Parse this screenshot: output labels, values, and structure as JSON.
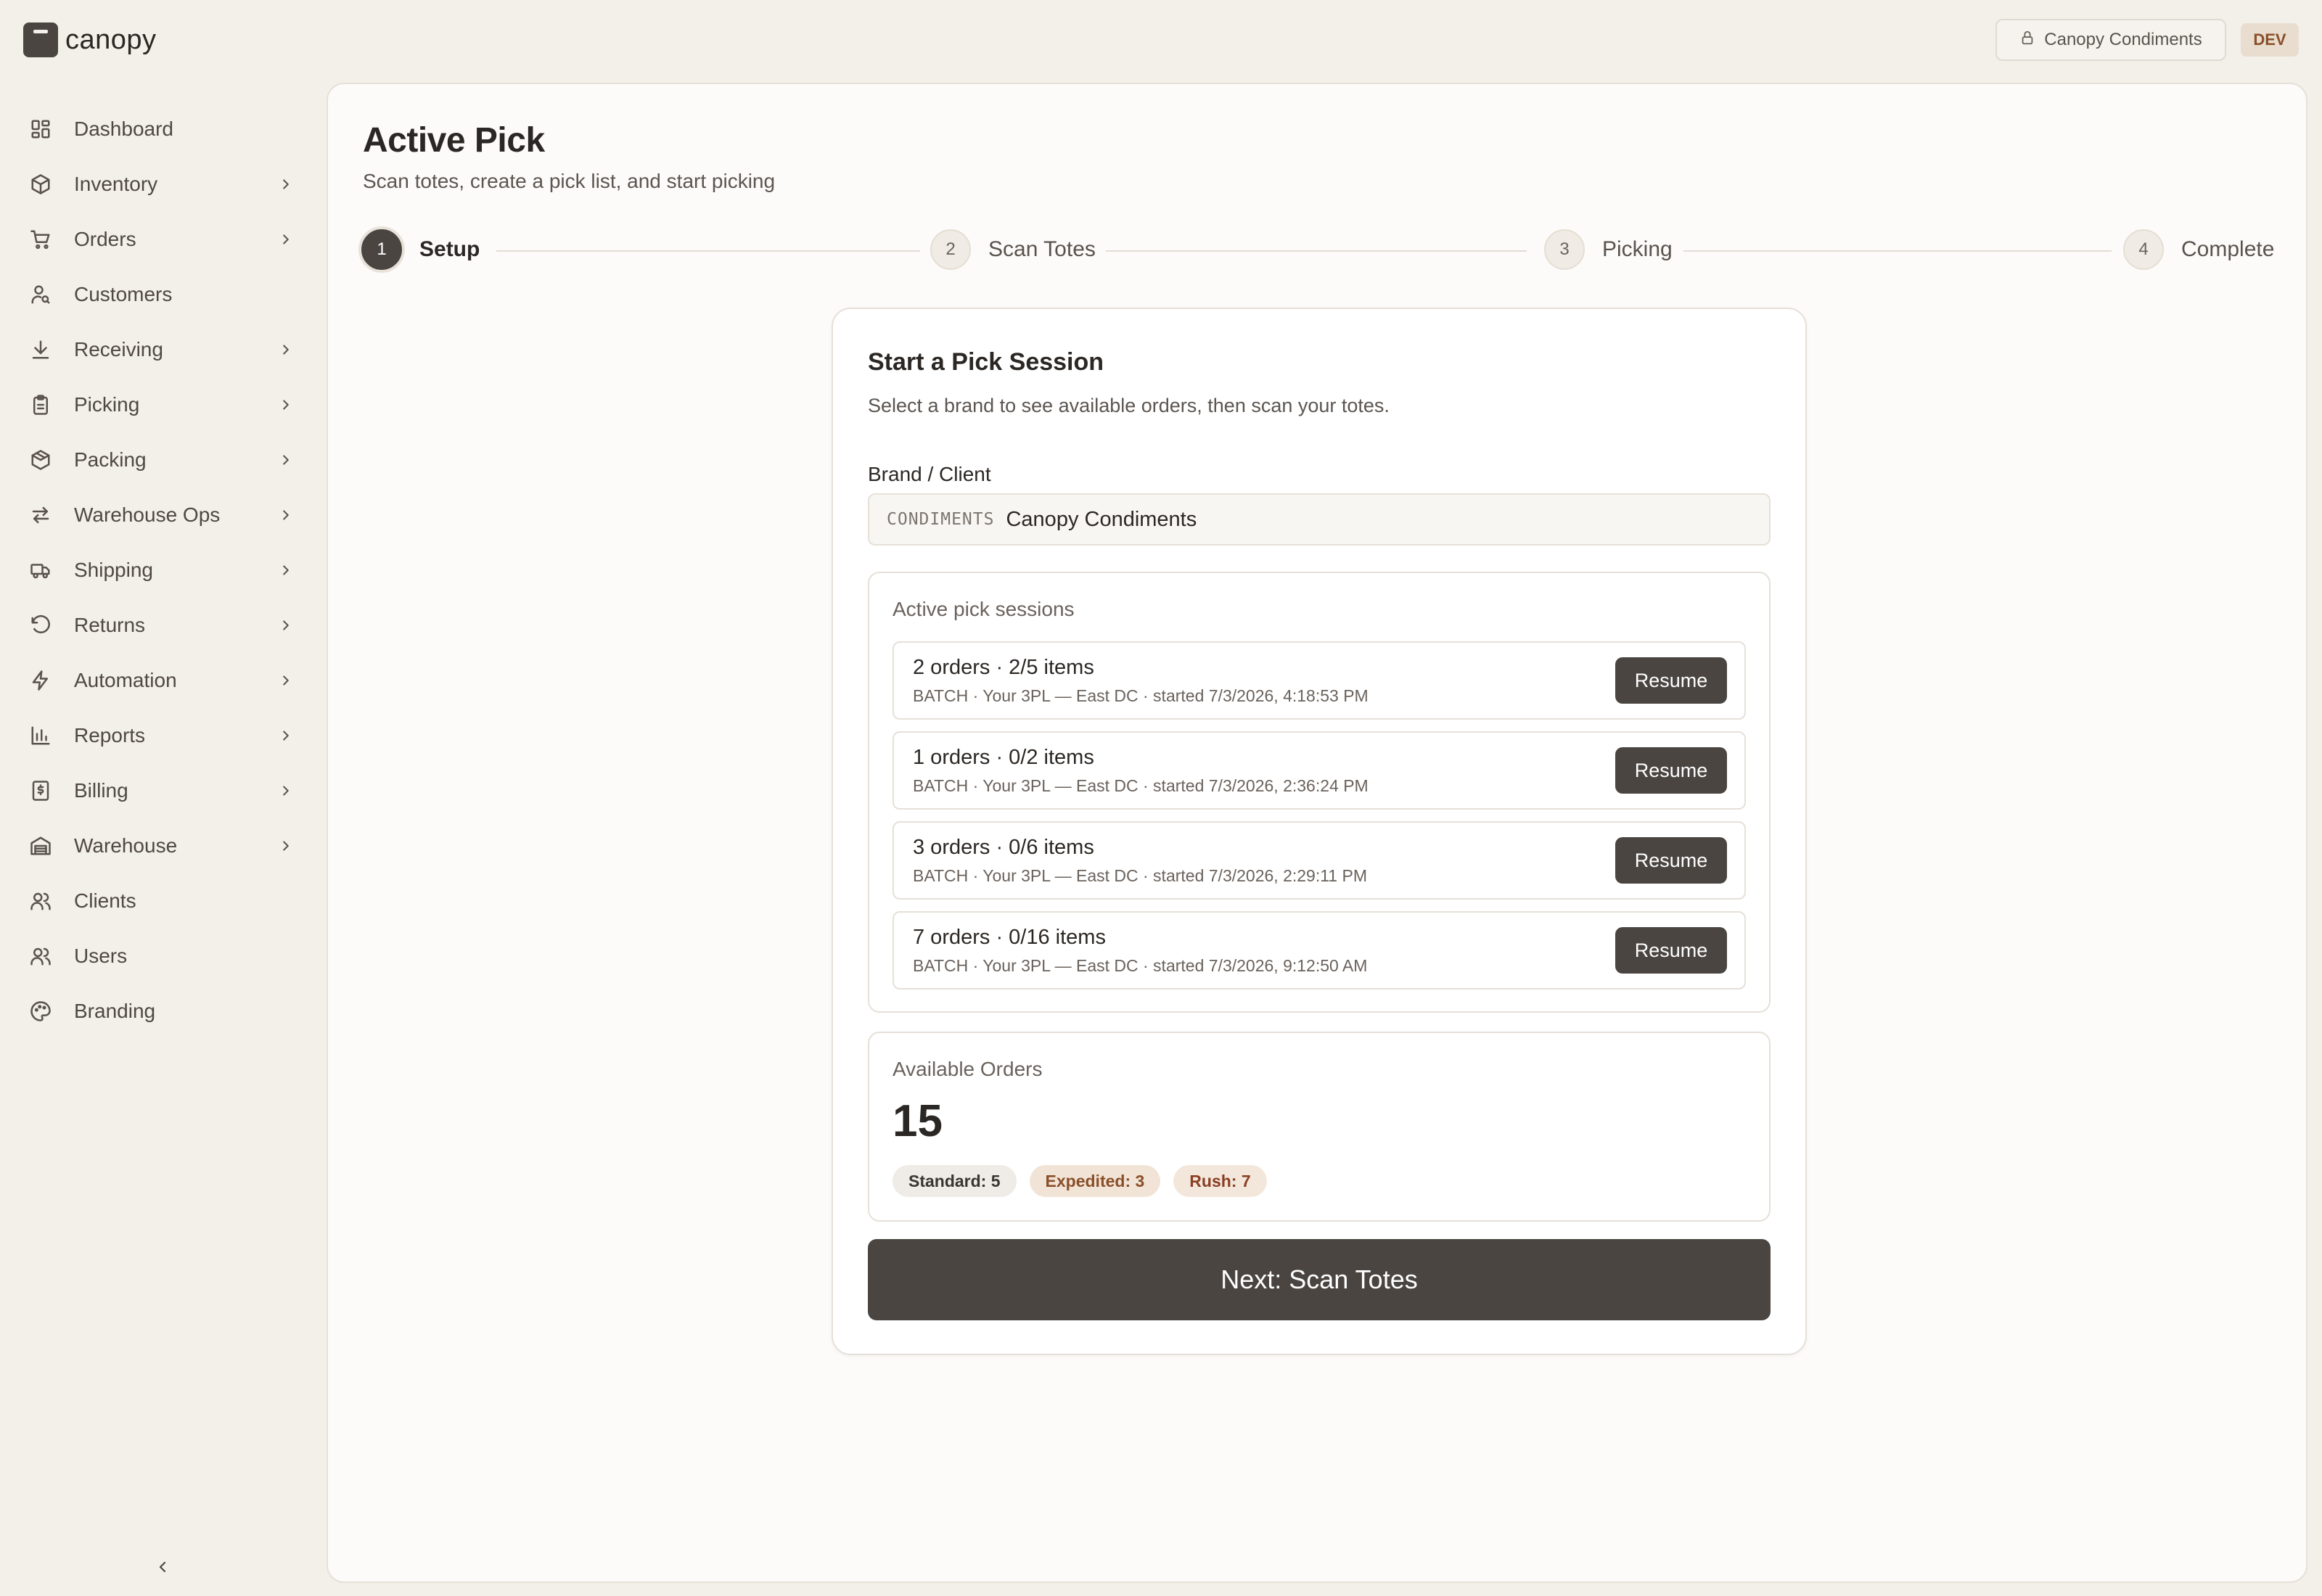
{
  "app": {
    "name": "canopy"
  },
  "topbar": {
    "client_label": "Canopy Condiments",
    "env_badge": "DEV"
  },
  "sidebar": {
    "items": [
      {
        "label": "Dashboard",
        "icon": "dashboard-icon",
        "has_submenu": false
      },
      {
        "label": "Inventory",
        "icon": "box-icon",
        "has_submenu": true
      },
      {
        "label": "Orders",
        "icon": "cart-icon",
        "has_submenu": true
      },
      {
        "label": "Customers",
        "icon": "user-search-icon",
        "has_submenu": false
      },
      {
        "label": "Receiving",
        "icon": "download-icon",
        "has_submenu": true
      },
      {
        "label": "Picking",
        "icon": "clipboard-icon",
        "has_submenu": true
      },
      {
        "label": "Packing",
        "icon": "package-icon",
        "has_submenu": true
      },
      {
        "label": "Warehouse Ops",
        "icon": "swap-arrows-icon",
        "has_submenu": true
      },
      {
        "label": "Shipping",
        "icon": "truck-icon",
        "has_submenu": true
      },
      {
        "label": "Returns",
        "icon": "rotate-ccw-icon",
        "has_submenu": true
      },
      {
        "label": "Automation",
        "icon": "lightning-icon",
        "has_submenu": true
      },
      {
        "label": "Reports",
        "icon": "bar-chart-icon",
        "has_submenu": true
      },
      {
        "label": "Billing",
        "icon": "receipt-dollar-icon",
        "has_submenu": true
      },
      {
        "label": "Warehouse",
        "icon": "warehouse-icon",
        "has_submenu": true
      },
      {
        "label": "Clients",
        "icon": "users-icon",
        "has_submenu": false
      },
      {
        "label": "Users",
        "icon": "users-icon",
        "has_submenu": false
      },
      {
        "label": "Branding",
        "icon": "palette-icon",
        "has_submenu": false
      }
    ]
  },
  "page": {
    "title": "Active Pick",
    "subtitle": "Scan totes, create a pick list, and start picking"
  },
  "stepper": {
    "steps": [
      {
        "num": "1",
        "label": "Setup",
        "active": true
      },
      {
        "num": "2",
        "label": "Scan Totes",
        "active": false
      },
      {
        "num": "3",
        "label": "Picking",
        "active": false
      },
      {
        "num": "4",
        "label": "Complete",
        "active": false
      }
    ]
  },
  "card": {
    "title": "Start a Pick Session",
    "subtitle": "Select a brand to see available orders, then scan your totes.",
    "brand_label": "Brand / Client",
    "brand_code": "CONDIMENTS",
    "brand_name": "Canopy Condiments",
    "sessions_title": "Active pick sessions",
    "sessions": [
      {
        "summary": "2 orders · 2/5 items",
        "meta": "BATCH · Your 3PL — East DC · started 7/3/2026, 4:18:53 PM",
        "action": "Resume"
      },
      {
        "summary": "1 orders · 0/2 items",
        "meta": "BATCH · Your 3PL — East DC · started 7/3/2026, 2:36:24 PM",
        "action": "Resume"
      },
      {
        "summary": "3 orders · 0/6 items",
        "meta": "BATCH · Your 3PL — East DC · started 7/3/2026, 2:29:11 PM",
        "action": "Resume"
      },
      {
        "summary": "7 orders · 0/16 items",
        "meta": "BATCH · Your 3PL — East DC · started 7/3/2026, 9:12:50 AM",
        "action": "Resume"
      }
    ],
    "available_title": "Available Orders",
    "available_count": "15",
    "chips": [
      {
        "label": "Standard: 5",
        "bg": "#efebe6",
        "fg": "#3a3531"
      },
      {
        "label": "Expedited: 3",
        "bg": "#f1e4d6",
        "fg": "#8a4f2a"
      },
      {
        "label": "Rush: 7",
        "bg": "#f3e7dc",
        "fg": "#8a3f22"
      }
    ],
    "next_button": "Next: Scan Totes"
  },
  "colors": {
    "accent": "#4a4541",
    "background": "#f3efe9",
    "panel": "#fcfbf9"
  }
}
